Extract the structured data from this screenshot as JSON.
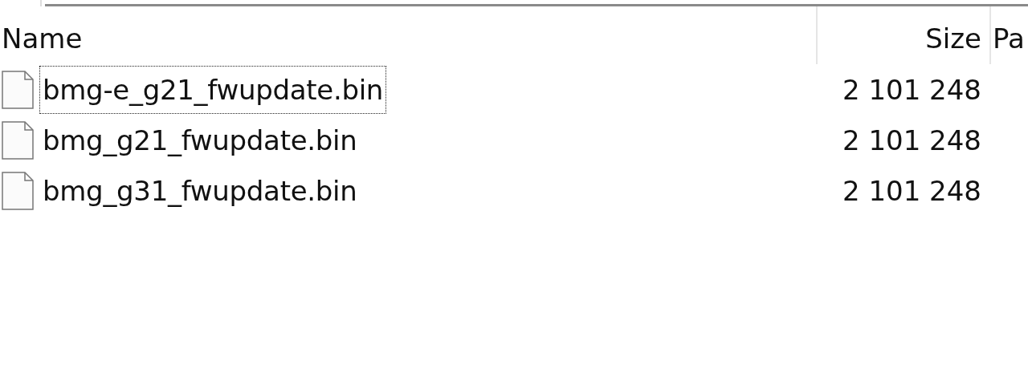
{
  "columns": [
    {
      "label": "Name",
      "kind": "text"
    },
    {
      "label": "Size",
      "kind": "number"
    },
    {
      "label": "Pa",
      "kind": "text"
    }
  ],
  "rows": [
    {
      "name": "bmg-e_g21_fwupdate.bin",
      "size": "2 101 248",
      "focused": true
    },
    {
      "name": "bmg_g21_fwupdate.bin",
      "size": "2 101 248",
      "focused": false
    },
    {
      "name": "bmg_g31_fwupdate.bin",
      "size": "2 101 248",
      "focused": false
    }
  ]
}
